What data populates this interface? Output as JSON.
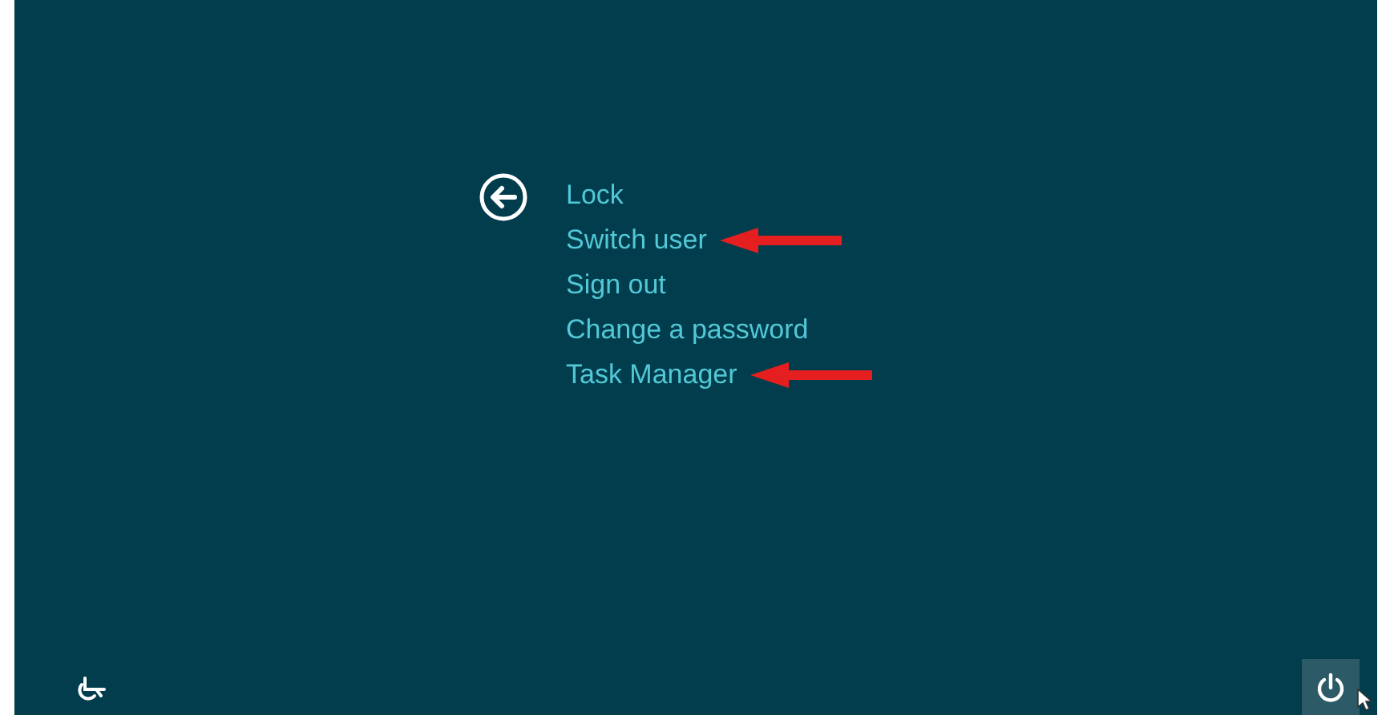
{
  "menu": {
    "items": [
      {
        "label": "Lock",
        "annotated": false
      },
      {
        "label": "Switch user",
        "annotated": true
      },
      {
        "label": "Sign out",
        "annotated": false
      },
      {
        "label": "Change a password",
        "annotated": false
      },
      {
        "label": "Task Manager",
        "annotated": true
      }
    ]
  }
}
